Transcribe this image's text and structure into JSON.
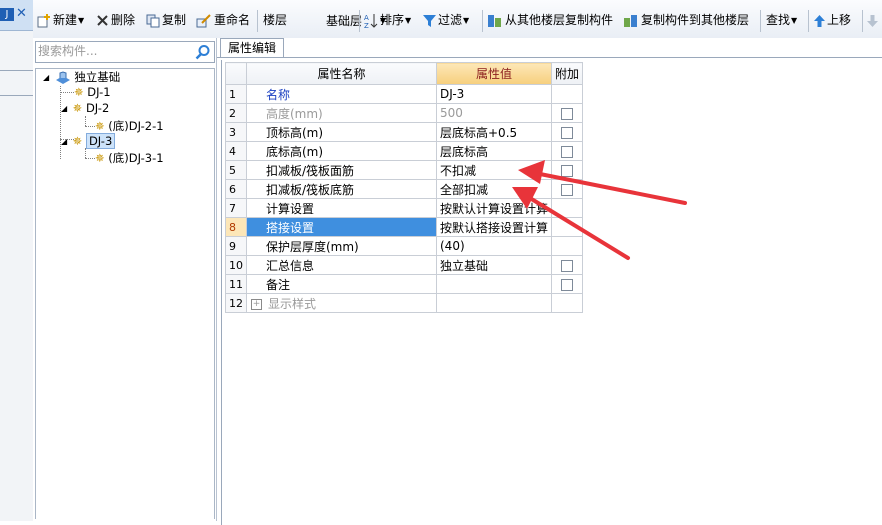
{
  "left_strip": {
    "tab_label": "J"
  },
  "toolbar": {
    "new": "新建",
    "delete": "删除",
    "copy": "复制",
    "rename": "重命名",
    "floor_label": "楼层",
    "floor_value": "基础层",
    "sort": "排序",
    "filter": "过滤",
    "copy_from": "从其他楼层复制构件",
    "copy_to": "复制构件到其他楼层",
    "find": "查找",
    "move_up": "上移"
  },
  "tree": {
    "search_placeholder": "搜索构件...",
    "root": "独立基础",
    "nodes": [
      "DJ-1",
      "DJ-2",
      "(底)DJ-2-1",
      "DJ-3",
      "(底)DJ-3-1"
    ]
  },
  "panel": {
    "tab": "属性编辑",
    "headers": {
      "name": "属性名称",
      "value": "属性值",
      "extra": "附加"
    },
    "rows": [
      {
        "num": "1",
        "name": "名称",
        "value": "DJ-3"
      },
      {
        "num": "2",
        "name": "高度(mm)",
        "value": "500"
      },
      {
        "num": "3",
        "name": "顶标高(m)",
        "value": "层底标高+0.5"
      },
      {
        "num": "4",
        "name": "底标高(m)",
        "value": "层底标高"
      },
      {
        "num": "5",
        "name": "扣减板/筏板面筋",
        "value": "不扣减"
      },
      {
        "num": "6",
        "name": "扣减板/筏板底筋",
        "value": "全部扣减"
      },
      {
        "num": "7",
        "name": "计算设置",
        "value": "按默认计算设置计算"
      },
      {
        "num": "8",
        "name": "搭接设置",
        "value": "按默认搭接设置计算"
      },
      {
        "num": "9",
        "name": "保护层厚度(mm)",
        "value": "(40)"
      },
      {
        "num": "10",
        "name": "汇总信息",
        "value": "独立基础"
      },
      {
        "num": "11",
        "name": "备注",
        "value": ""
      },
      {
        "num": "12",
        "name": "显示样式",
        "value": ""
      }
    ]
  },
  "colors": {
    "selection": "#3f8fdf",
    "header_value_bg": "#f6cf7d",
    "arrow": "#e8343a"
  },
  "icons": [
    "new-icon",
    "delete-icon",
    "copy-icon",
    "rename-icon",
    "sort-icon",
    "filter-icon",
    "copy-from-floor-icon",
    "copy-to-floor-icon",
    "up-arrow-icon",
    "down-arrow-icon",
    "search-icon",
    "foundation-icon",
    "gear-icon"
  ]
}
